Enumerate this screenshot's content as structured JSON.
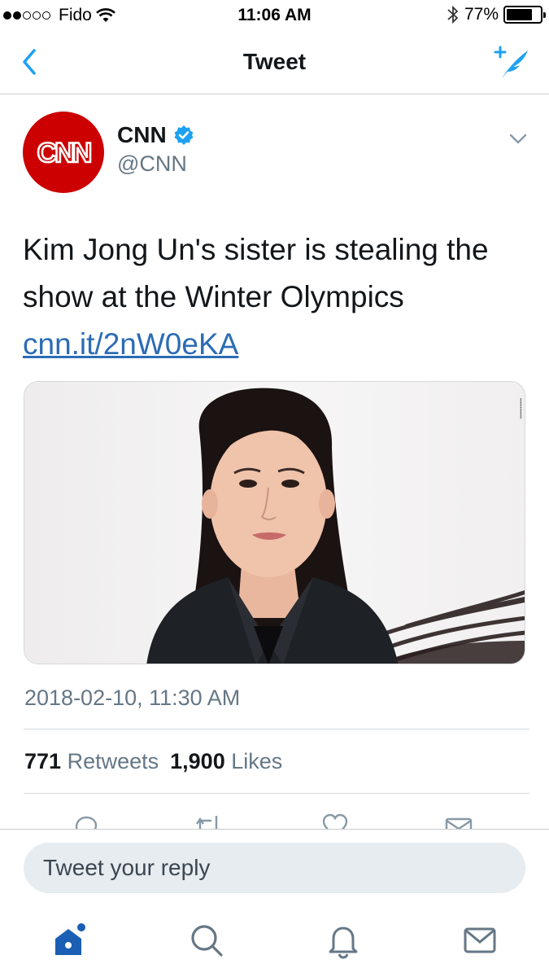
{
  "status_bar": {
    "carrier": "Fido",
    "time": "11:06 AM",
    "battery_text": "77%",
    "battery_level": 0.77,
    "signal_bars_filled": 2,
    "signal_bars_total": 5
  },
  "nav": {
    "title": "Tweet",
    "back_icon": "chevron-left-icon",
    "compose_icon": "compose-tweet-icon"
  },
  "tweet": {
    "author_name": "CNN",
    "author_handle": "@CNN",
    "avatar_text": "CNN",
    "text_before_link": "Kim Jong Un's sister is stealing the show at the Winter Olympics ",
    "link_text": "cnn.it/2nW0eKA",
    "timestamp": "2018-02-10, 11:30 AM",
    "retweets_count": "771",
    "retweets_label": "Retweets",
    "likes_count": "1,900",
    "likes_label": "Likes"
  },
  "actions": [
    "reply-icon",
    "retweet-icon",
    "like-icon",
    "share-icon"
  ],
  "reply": {
    "placeholder": "Tweet your reply"
  },
  "tabbar": [
    "home-icon",
    "search-icon",
    "notifications-icon",
    "messages-icon"
  ],
  "colors": {
    "accent": "#1da1f2",
    "link": "#2b6cb5",
    "tab_active": "#1a5fb4",
    "cnn_red": "#cc0000",
    "secondary_text": "#657786"
  }
}
